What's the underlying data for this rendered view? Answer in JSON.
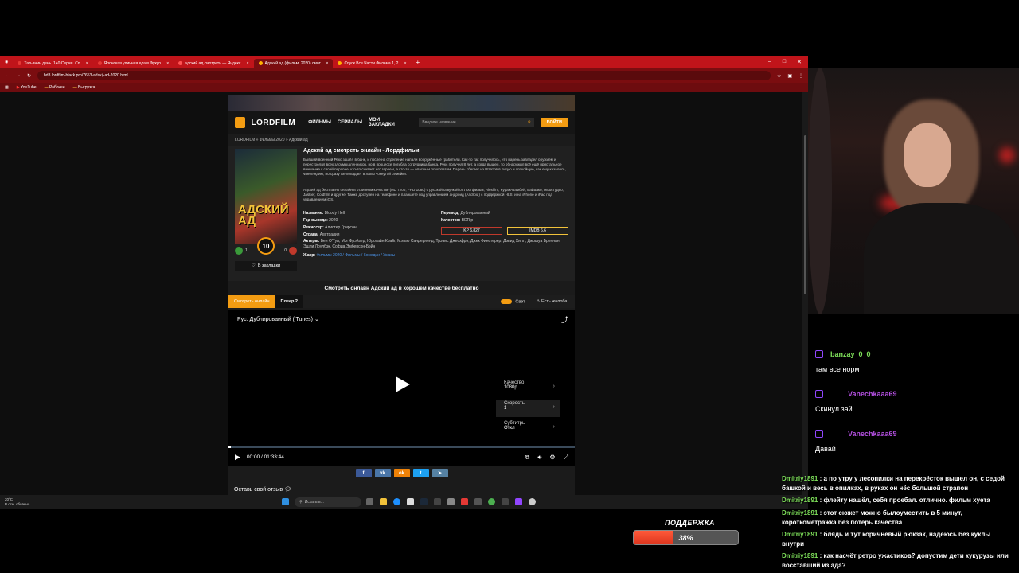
{
  "browser": {
    "tabs": [
      {
        "label": "Татьянин день. 140 Серия. Сп..."
      },
      {
        "label": "Японская уличная еда в Фукуо..."
      },
      {
        "label": "адский ад смотреть — Яндекс..."
      },
      {
        "label": "Адский ад (фильм, 2020) смот..."
      },
      {
        "label": "Спуск Все Части Фильма 1, 2..."
      }
    ],
    "url": "hd3.lordfilm-black.pro/7653-adskij-ad-2020.html",
    "bookmarks": [
      "YouTube",
      "Рабочее",
      "Выгрузка"
    ]
  },
  "site": {
    "logo": "LORDFILM",
    "nav": [
      "ФИЛЬМЫ",
      "СЕРИАЛЫ",
      "МОИ ЗАКЛАДКИ"
    ],
    "search_placeholder": "Введите название",
    "login": "ВОЙТИ",
    "breadcrumb": "LORDFILM » Фильмы 2020 » Адский ад"
  },
  "movie": {
    "poster_title": "АДСКИЙ АД",
    "rating": "10",
    "likes": "1",
    "dislikes": "0",
    "bookmark_label": "В закладки",
    "title": "Адский ад смотреть онлайн - Лордфильм",
    "desc1": "Бывший военный Рекс зашёл в банк, и после на отделение напали вооружённые грабители. Как-то так получилось, что парень завладел оружием и перестрелял всех злоумышленников, но в процессе погибла сотрудница банка. Рекс получил 8 лет, а когда вышел, то обнаружил всё ещё пристальное внимание к своей персоне: кто-то считает его героем, а кто-то — опасным психопатом. Парень сбегает из Штатов в тихую и спокойную, как ему казалось, Финляндию, но сразу же попадает в лапы чокнутой семейки.",
    "desc2": "Адский ад бесплатно онлайн в отличном качестве (HD 720p, FHD 1080) с русской озвучкой от Лостфильм, Alexfilm, Кураж-Бамбей, БайБако, Ньюстудио, Jaskier, Coldfilm и другие. Также доступен на телефоне и планшете под управлением андроид (Android) с поддержкой HLS, и на iPhone и iPad под управлением iOS.",
    "name_label": "Название:",
    "name": "Bloody Hell",
    "year_label": "Год выхода:",
    "year": "2020",
    "director_label": "Режиссер:",
    "director": "Алистер Грирсон",
    "country_label": "Страна:",
    "country": "Австралия",
    "translation_label": "Перевод:",
    "translation": "Дублированный",
    "quality_label": "Качество:",
    "quality": "BDRip",
    "kp": "KP 6.827",
    "imdb": "IMDB 6.6",
    "actors_label": "Актеры:",
    "actors": "Бен О'Тул, Мэг Фрэйзер, Юрохайн Крайг, Мэтью Сандерленд, Трэвис Джеффри, Джек Финстерер, Дэвид Хилл, Джошуа Бреннан, Эшли Лоулбэк, Софиа Эмберсон-Бэйн",
    "genre_label": "Жанр:",
    "genres": "Фильмы 2020 / Фильмы / Комедии / Ужасы"
  },
  "player": {
    "heading": "Смотреть онлайн Адский ад в хорошем качестве бесплатно",
    "tab1": "Смотреть онлайн",
    "tab2": "Плеер 2",
    "light": "Свет",
    "complaint": "Есть жалоба!",
    "dub": "Рус. Дублированный (iTunes)",
    "settings": [
      {
        "label": "Качество",
        "value": "1080p"
      },
      {
        "label": "Скорость",
        "value": "1"
      },
      {
        "label": "Субтитры",
        "value": "Откл"
      }
    ],
    "time": "00:00 / 01:33:44",
    "progress": 0.0
  },
  "share": [
    "f",
    "vk",
    "ok",
    "tw",
    "tg"
  ],
  "review": "Оставь свой отзыв",
  "taskbar": {
    "temp": "20°C",
    "weather": "В осн. облачно",
    "search": "Искать в..."
  },
  "chat": {
    "messages": [
      {
        "user": "banzay_0_0",
        "text": "там все норм",
        "color": "#7ee05a"
      },
      {
        "user": "Vanechkaaa69",
        "text": "Скинул зай",
        "color": "#b34fe0"
      },
      {
        "user": "Vanechkaaa69",
        "text": "Давай",
        "color": "#b34fe0"
      }
    ]
  },
  "overlay_chat": [
    {
      "user": "Dmitriy1891",
      "text": "а по утру у лесопилки на перекрёсток вышел он, с седой башкой и весь в опилках, в руках он нёс большой страпон"
    },
    {
      "user": "Dmitriy1891",
      "text": "флейту нашёл, себя проебал. отлично. фильм хуета"
    },
    {
      "user": "Dmitriy1891",
      "text": "этот сюжет можно былоуместить в 5 минут, короткометражка без потерь качества"
    },
    {
      "user": "Dmitriy1891",
      "text": "блядь и тут коричневый рюкзак, надеюсь без куклы внутри"
    },
    {
      "user": "Dmitriy1891",
      "text": "как насчёт ретро ужастиков? допустим дети кукурузы или восставший из ада?"
    }
  ],
  "support": {
    "label": "ПОДДЕРЖКА",
    "percent": 38,
    "percent_text": "38%"
  }
}
